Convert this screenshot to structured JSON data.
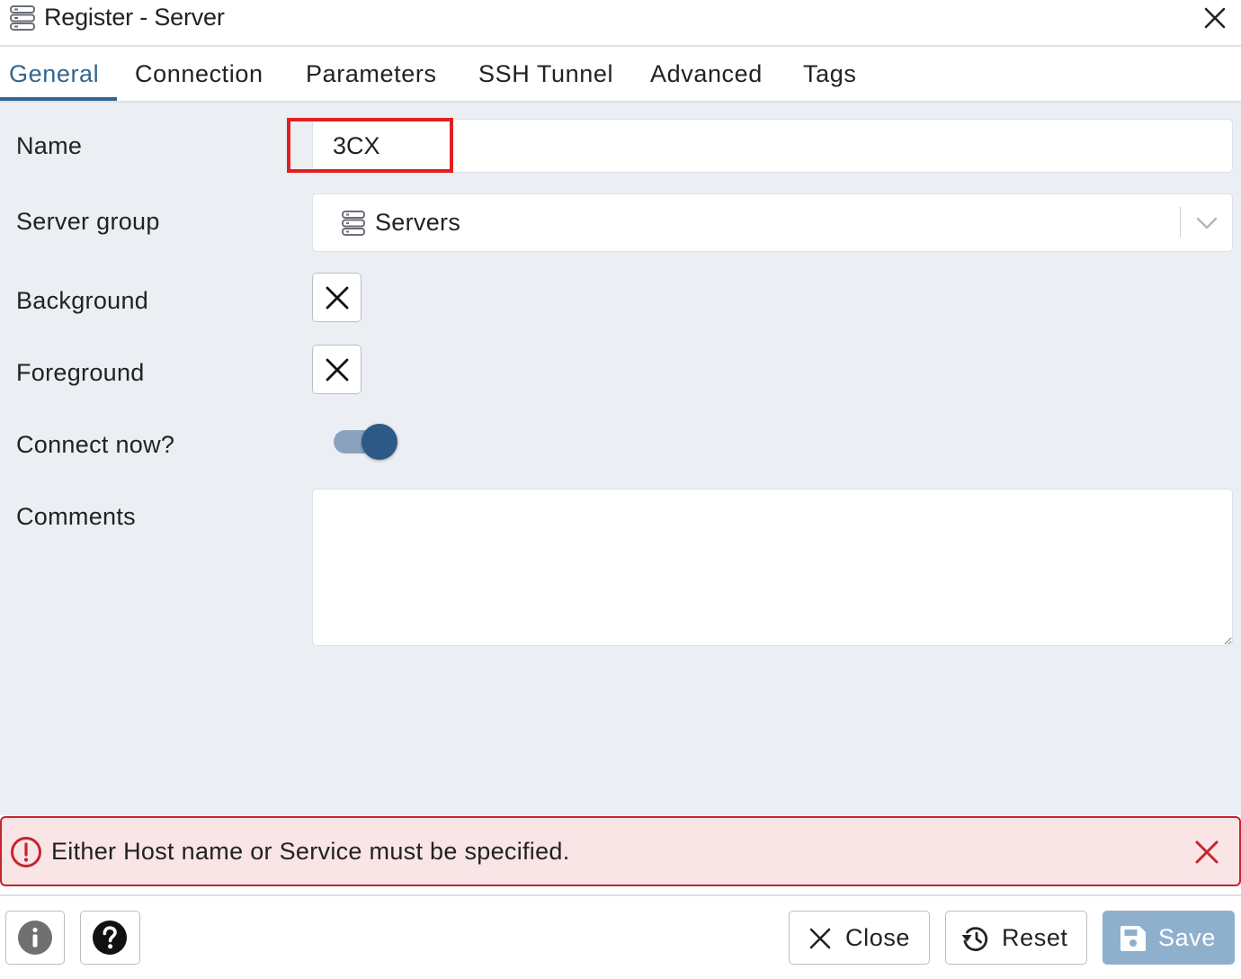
{
  "dialog": {
    "title": "Register - Server",
    "icon": "server-icon"
  },
  "tabs": [
    {
      "label": "General",
      "active": true
    },
    {
      "label": "Connection",
      "active": false
    },
    {
      "label": "Parameters",
      "active": false
    },
    {
      "label": "SSH Tunnel",
      "active": false
    },
    {
      "label": "Advanced",
      "active": false
    },
    {
      "label": "Tags",
      "active": false
    }
  ],
  "form": {
    "name": {
      "label": "Name",
      "value": "3CX"
    },
    "server_group": {
      "label": "Server group",
      "value": "Servers",
      "icon": "server-group-icon"
    },
    "background": {
      "label": "Background",
      "icon": "cross-icon"
    },
    "foreground": {
      "label": "Foreground",
      "icon": "cross-icon"
    },
    "connect_now": {
      "label": "Connect now?",
      "checked": true
    },
    "comments": {
      "label": "Comments",
      "value": ""
    }
  },
  "error": {
    "message": "Either Host name or Service must be specified.",
    "color": "#c8242d"
  },
  "footer": {
    "info_icon": "info-icon",
    "help_icon": "help-icon",
    "close_label": "Close",
    "reset_label": "Reset",
    "save_label": "Save"
  },
  "colors": {
    "accent": "#326690",
    "toggle_knob": "#2c5985",
    "form_background": "#ebeef3",
    "save_button": "#8fb0cd",
    "highlight": "#e02020"
  }
}
